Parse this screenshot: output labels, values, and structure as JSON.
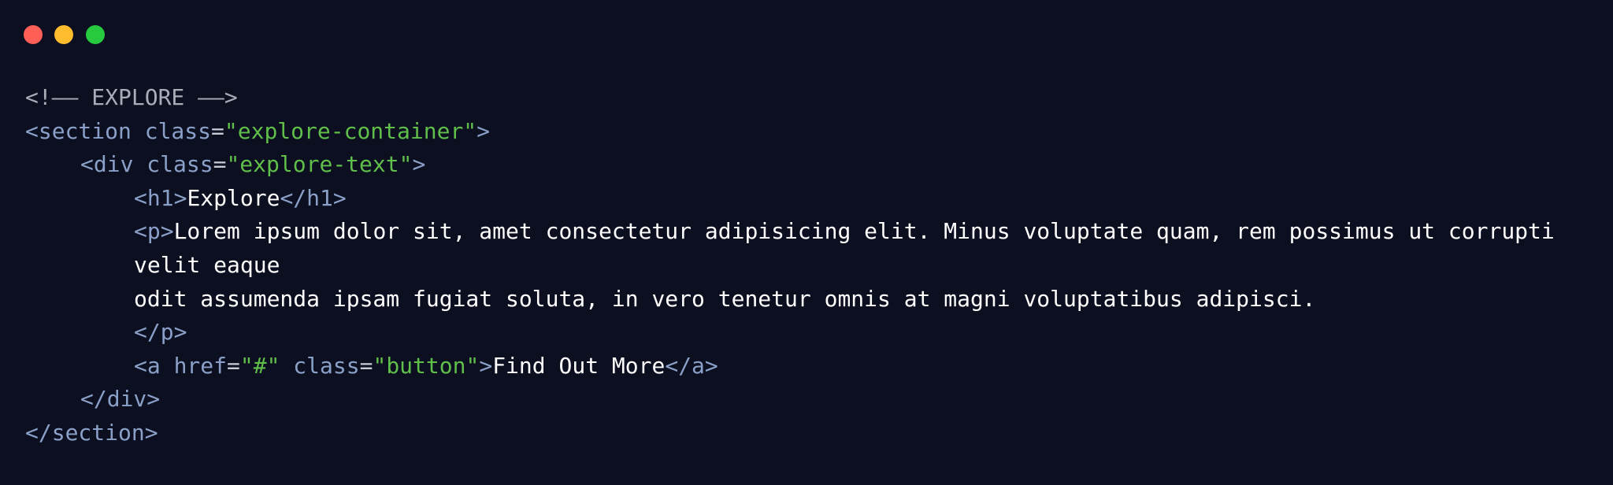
{
  "window": {
    "background": "#0c0f20",
    "traffic_lights": {
      "close_color": "#ff5f56",
      "minimize_color": "#ffbd2e",
      "maximize_color": "#27c93f"
    }
  },
  "syntax_colors": {
    "comment": "#a9adb8",
    "tag": "#8aa0c8",
    "string": "#5fbf4a",
    "text": "#ffffff"
  },
  "code": {
    "comment": "<!—— EXPLORE ——>",
    "section_open": "<section",
    "class_attr": " class",
    "equals": "=",
    "section_class": "\"explore-container\"",
    "close_bracket": ">",
    "div_open": "<div",
    "div_class": "\"explore-text\"",
    "h1_open": "<h1>",
    "h1_text": "Explore",
    "h1_close": "</h1>",
    "p_open": "<p>",
    "p_text_1": "Lorem ipsum dolor sit, amet consectetur adipisicing elit. Minus voluptate quam, rem possimus ut corrupti velit eaque",
    "p_text_2": "odit assumenda ipsam fugiat soluta, in vero tenetur omnis at magni voluptatibus adipisci.",
    "p_close": "</p>",
    "a_open": "<a",
    "href_attr": " href",
    "href_value": "\"#\"",
    "a_class": "\"button\"",
    "a_text": "Find Out More",
    "a_close": "</a>",
    "div_close": "</div>",
    "section_close": "</section>"
  }
}
